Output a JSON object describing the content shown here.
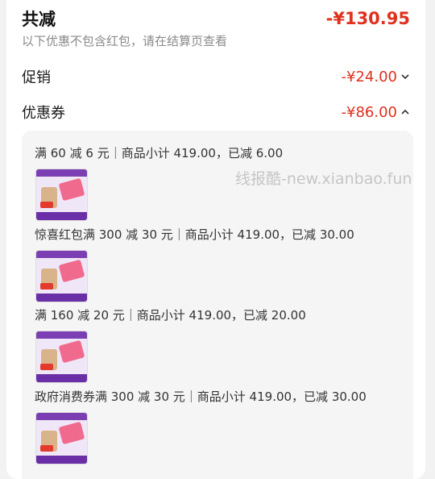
{
  "summary": {
    "title": "共减",
    "total": "-¥130.95",
    "note": "以下优惠不包含红包，请在结算页查看"
  },
  "promo": {
    "label": "促销",
    "amount": "-¥24.00"
  },
  "coupon": {
    "label": "优惠券",
    "amount": "-¥86.00"
  },
  "details": [
    {
      "text": "满 60 减 6 元｜商品小计 419.00，已减 6.00"
    },
    {
      "text": "惊喜红包满 300 减 30 元｜商品小计 419.00，已减 30.00"
    },
    {
      "text": "满 160 减 20 元｜商品小计 419.00，已减 20.00"
    },
    {
      "text": "政府消费券满 300 减 30 元｜商品小计 419.00，已减 30.00"
    }
  ],
  "watermark": "线报酷-new.xianbao.fun",
  "colors": {
    "accent": "#e0301e",
    "muted": "#8a8a8a",
    "panel": "#f5f5f5"
  },
  "icons": {
    "promo_toggle": "chevron-down-icon",
    "coupon_toggle": "chevron-up-icon"
  }
}
